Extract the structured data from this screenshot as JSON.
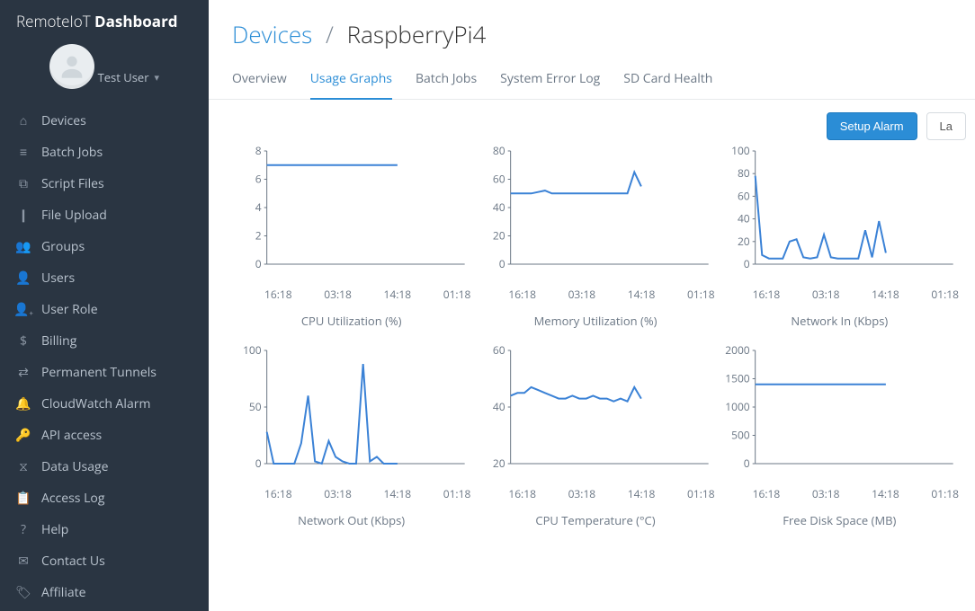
{
  "brand": {
    "light": "RemoteIoT ",
    "bold": "Dashboard"
  },
  "profile": {
    "name": "Test User"
  },
  "sidebar": {
    "items": [
      {
        "icon": "home",
        "label": "Devices"
      },
      {
        "icon": "list",
        "label": "Batch Jobs"
      },
      {
        "icon": "copy",
        "label": "Script Files"
      },
      {
        "icon": "file",
        "label": "File Upload"
      },
      {
        "icon": "group",
        "label": "Groups"
      },
      {
        "icon": "user",
        "label": "Users"
      },
      {
        "icon": "user-plus",
        "label": "User Role"
      },
      {
        "icon": "dollar",
        "label": "Billing"
      },
      {
        "icon": "exchange",
        "label": "Permanent Tunnels"
      },
      {
        "icon": "bell",
        "label": "CloudWatch Alarm"
      },
      {
        "icon": "key",
        "label": "API access"
      },
      {
        "icon": "hourglass",
        "label": "Data Usage"
      },
      {
        "icon": "clipboard",
        "label": "Access Log"
      },
      {
        "icon": "question",
        "label": "Help"
      },
      {
        "icon": "mail",
        "label": "Contact Us"
      },
      {
        "icon": "badge",
        "label": "Affiliate"
      }
    ]
  },
  "breadcrumb": {
    "root": "Devices",
    "sep": "/",
    "current": "RaspberryPi4"
  },
  "tabs": [
    {
      "label": "Overview",
      "active": false
    },
    {
      "label": "Usage Graphs",
      "active": true
    },
    {
      "label": "Batch Jobs",
      "active": false
    },
    {
      "label": "System Error Log",
      "active": false
    },
    {
      "label": "SD Card Health",
      "active": false
    }
  ],
  "toolbar": {
    "primary": "Setup Alarm",
    "secondary": "La"
  },
  "chart_data": [
    {
      "type": "line",
      "title": "CPU Utilization (%)",
      "x_labels": [
        "16:18",
        "03:18",
        "14:18",
        "01:18"
      ],
      "y_ticks": [
        0,
        2,
        4,
        6,
        8
      ],
      "ylim": [
        0,
        8
      ],
      "series": [
        {
          "name": "cpu",
          "values": [
            7,
            7,
            7,
            7,
            7,
            7,
            7,
            7,
            7,
            7,
            7,
            7,
            7,
            7,
            7,
            7,
            7,
            7,
            7,
            7
          ]
        }
      ],
      "data_fraction": 0.66
    },
    {
      "type": "line",
      "title": "Memory Utilization (%)",
      "x_labels": [
        "16:18",
        "03:18",
        "14:18",
        "01:18"
      ],
      "y_ticks": [
        0,
        20,
        40,
        60,
        80
      ],
      "ylim": [
        0,
        80
      ],
      "series": [
        {
          "name": "mem",
          "values": [
            50,
            50,
            50,
            50,
            51,
            52,
            50,
            50,
            50,
            50,
            50,
            50,
            50,
            50,
            50,
            50,
            50,
            50,
            65,
            55
          ]
        }
      ],
      "data_fraction": 0.66
    },
    {
      "type": "line",
      "title": "Network In (Kbps)",
      "x_labels": [
        "16:18",
        "03:18",
        "14:18",
        "01:18"
      ],
      "y_ticks": [
        0,
        20,
        40,
        60,
        80,
        100
      ],
      "ylim": [
        0,
        100
      ],
      "series": [
        {
          "name": "in",
          "values": [
            78,
            8,
            5,
            5,
            5,
            20,
            22,
            6,
            5,
            6,
            26,
            6,
            5,
            5,
            5,
            5,
            30,
            6,
            38,
            10
          ]
        }
      ],
      "data_fraction": 0.66
    },
    {
      "type": "line",
      "title": "Network Out (Kbps)",
      "x_labels": [
        "16:18",
        "03:18",
        "14:18",
        "01:18"
      ],
      "y_ticks": [
        0,
        50,
        100
      ],
      "ylim": [
        0,
        100
      ],
      "series": [
        {
          "name": "out",
          "values": [
            28,
            0,
            0,
            0,
            0,
            18,
            60,
            2,
            0,
            20,
            6,
            2,
            0,
            0,
            88,
            2,
            6,
            0,
            0,
            0
          ]
        }
      ],
      "data_fraction": 0.66
    },
    {
      "type": "line",
      "title": "CPU Temperature (°C)",
      "x_labels": [
        "16:18",
        "03:18",
        "14:18",
        "01:18"
      ],
      "y_ticks": [
        20,
        40,
        60
      ],
      "ylim": [
        20,
        60
      ],
      "series": [
        {
          "name": "temp",
          "values": [
            44,
            45,
            45,
            47,
            46,
            45,
            44,
            43,
            43,
            44,
            43,
            43,
            44,
            43,
            43,
            42,
            43,
            42,
            47,
            43
          ]
        }
      ],
      "data_fraction": 0.66
    },
    {
      "type": "line",
      "title": "Free Disk Space (MB)",
      "x_labels": [
        "16:18",
        "03:18",
        "14:18",
        "01:18"
      ],
      "y_ticks": [
        0,
        500,
        1000,
        1500,
        2000
      ],
      "ylim": [
        0,
        2000
      ],
      "series": [
        {
          "name": "disk",
          "values": [
            1400,
            1400,
            1400,
            1400,
            1400,
            1400,
            1400,
            1400,
            1400,
            1400,
            1400,
            1400,
            1400,
            1400,
            1400,
            1400,
            1400,
            1400,
            1400,
            1400
          ]
        }
      ],
      "data_fraction": 0.66
    }
  ]
}
